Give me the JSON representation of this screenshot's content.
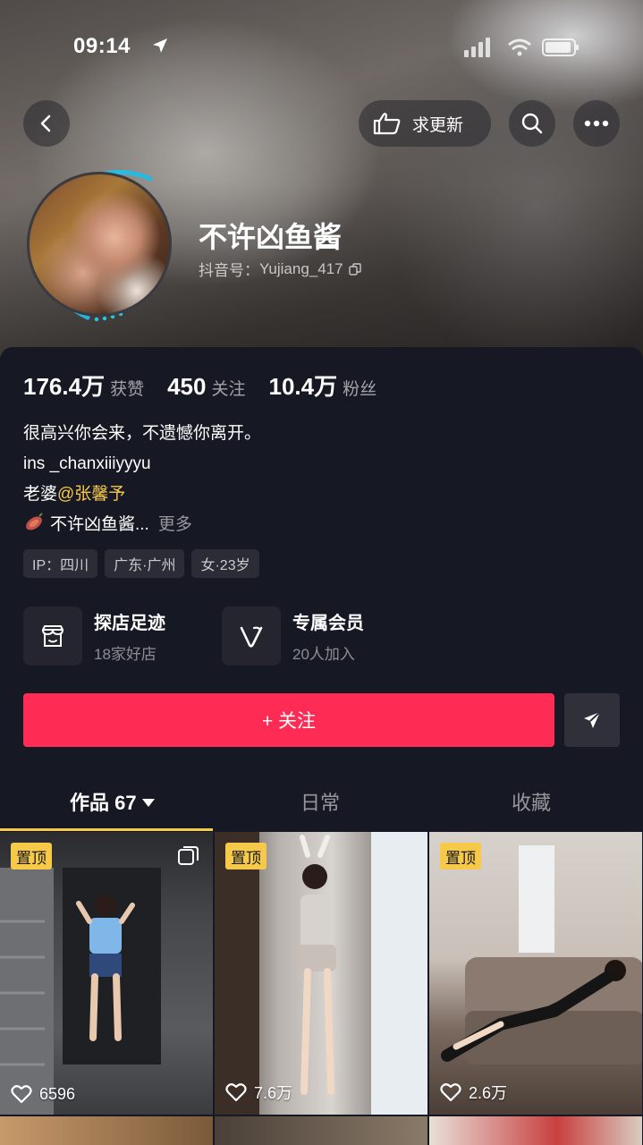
{
  "status_bar": {
    "time": "09:14"
  },
  "header": {
    "update_label": "求更新"
  },
  "profile": {
    "name": "不许凶鱼酱",
    "id_label": "抖音号：",
    "id_value": "Yujiang_417"
  },
  "stats": [
    {
      "value": "176.4万",
      "label": "获赞"
    },
    {
      "value": "450",
      "label": "关注"
    },
    {
      "value": "10.4万",
      "label": "粉丝"
    }
  ],
  "bio": {
    "line1": "很高兴你会来，不遗憾你离开。",
    "line2": "ins _chanxiiiyyyu",
    "line3_prefix": "老婆",
    "line3_mention": "@张馨予",
    "line4_text": "不许凶鱼酱...",
    "line4_more": "更多"
  },
  "tags": [
    "IP：四川",
    "广东·广州",
    "女·23岁"
  ],
  "features": [
    {
      "title": "探店足迹",
      "sub": "18家好店",
      "icon": "shop-icon"
    },
    {
      "title": "专属会员",
      "sub": "20人加入",
      "icon": "vip-v-icon"
    }
  ],
  "actions": {
    "follow_label": "+ 关注"
  },
  "tabs": [
    {
      "label": "作品 67",
      "active": true
    },
    {
      "label": "日常",
      "active": false
    },
    {
      "label": "收藏",
      "active": false
    }
  ],
  "videos": [
    {
      "pinned_label": "置顶",
      "likes": "6596",
      "multi": true
    },
    {
      "pinned_label": "置顶",
      "likes": "7.6万",
      "multi": false
    },
    {
      "pinned_label": "置顶",
      "likes": "2.6万",
      "multi": false
    }
  ],
  "colors": {
    "accent": "#fe2c55",
    "pin": "#f7c948",
    "background": "#161823"
  }
}
